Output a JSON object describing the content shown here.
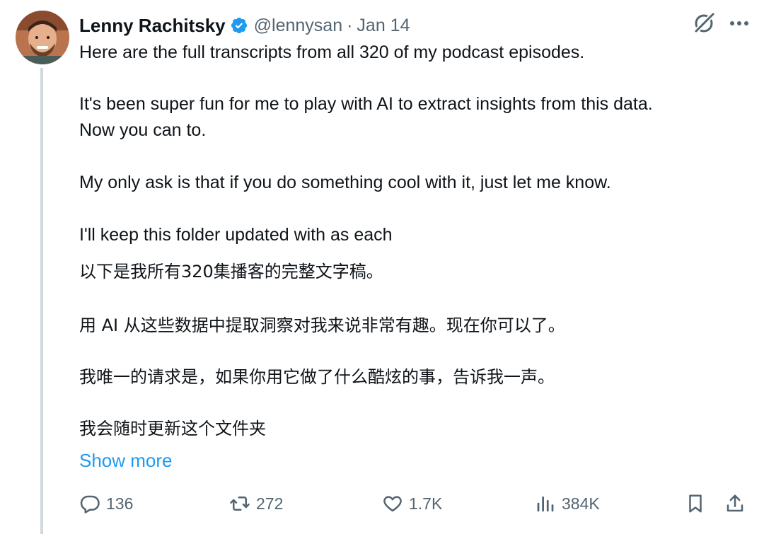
{
  "tweet": {
    "author_name": "Lenny Rachitsky",
    "handle": "@lennysan",
    "separator": "·",
    "date": "Jan 14",
    "paragraphs": [
      "Here are the full transcripts from all 320 of my podcast episodes.",
      "It's been super fun for me to play with AI to extract insights from this data.\nNow you can to.",
      "My only ask is that if you do something cool with it, just let me know.",
      "I'll keep this folder updated with as each"
    ],
    "translation": [
      "以下是我所有320集播客的完整文字稿。",
      "用 AI 从这些数据中提取洞察对我来说非常有趣。现在你可以了。",
      "我唯一的请求是，如果你用它做了什么酷炫的事，告诉我一声。",
      "我会随时更新这个文件夹"
    ],
    "show_more": "Show more"
  },
  "actions": {
    "replies": "136",
    "reposts": "272",
    "likes": "1.7K",
    "views": "384K"
  },
  "icons": {
    "verified": "verified-badge-icon",
    "grok": "grok-icon",
    "more": "more-icon",
    "reply": "reply-icon",
    "repost": "repost-icon",
    "like": "heart-icon",
    "views": "views-icon",
    "bookmark": "bookmark-icon",
    "share": "share-icon"
  },
  "colors": {
    "text": "#0f1419",
    "secondary": "#536471",
    "accent": "#1d9bf0",
    "thread_line": "#cfd9de"
  }
}
